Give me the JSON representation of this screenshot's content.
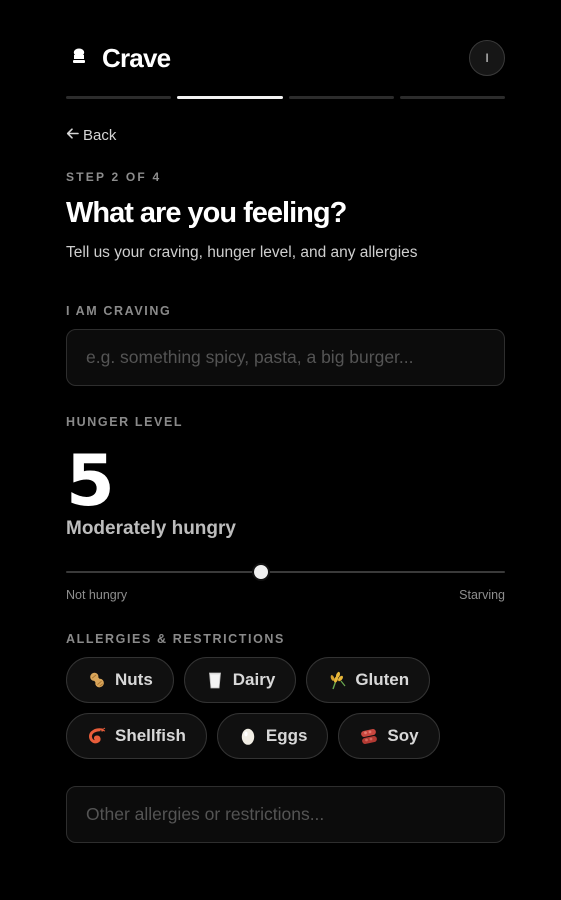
{
  "header": {
    "brand": "Crave",
    "avatar_initial": "I",
    "progress_total": 4,
    "progress_active_index": 1
  },
  "nav": {
    "back_label": "Back"
  },
  "step": {
    "indicator": "STEP 2 OF 4",
    "title": "What are you feeling?",
    "subtitle": "Tell us your craving, hunger level, and any allergies"
  },
  "craving": {
    "label": "I AM CRAVING",
    "placeholder": "e.g. something spicy, pasta, a big burger...",
    "value": ""
  },
  "hunger": {
    "label": "HUNGER LEVEL",
    "value": "5",
    "description": "Moderately hungry",
    "min_label": "Not hungry",
    "max_label": "Starving",
    "slider_fraction": 0.445
  },
  "allergies": {
    "label": "ALLERGIES & RESTRICTIONS",
    "chips": [
      {
        "label": "Nuts",
        "icon": "peanut-icon"
      },
      {
        "label": "Dairy",
        "icon": "milk-glass-icon"
      },
      {
        "label": "Gluten",
        "icon": "wheat-icon"
      },
      {
        "label": "Shellfish",
        "icon": "shrimp-icon"
      },
      {
        "label": "Eggs",
        "icon": "egg-icon"
      },
      {
        "label": "Soy",
        "icon": "soybean-icon"
      }
    ],
    "other_placeholder": "Other allergies or restrictions...",
    "other_value": ""
  },
  "colors": {
    "background": "#000000",
    "accent": "#ffffff",
    "muted": "#8a8a8a"
  }
}
